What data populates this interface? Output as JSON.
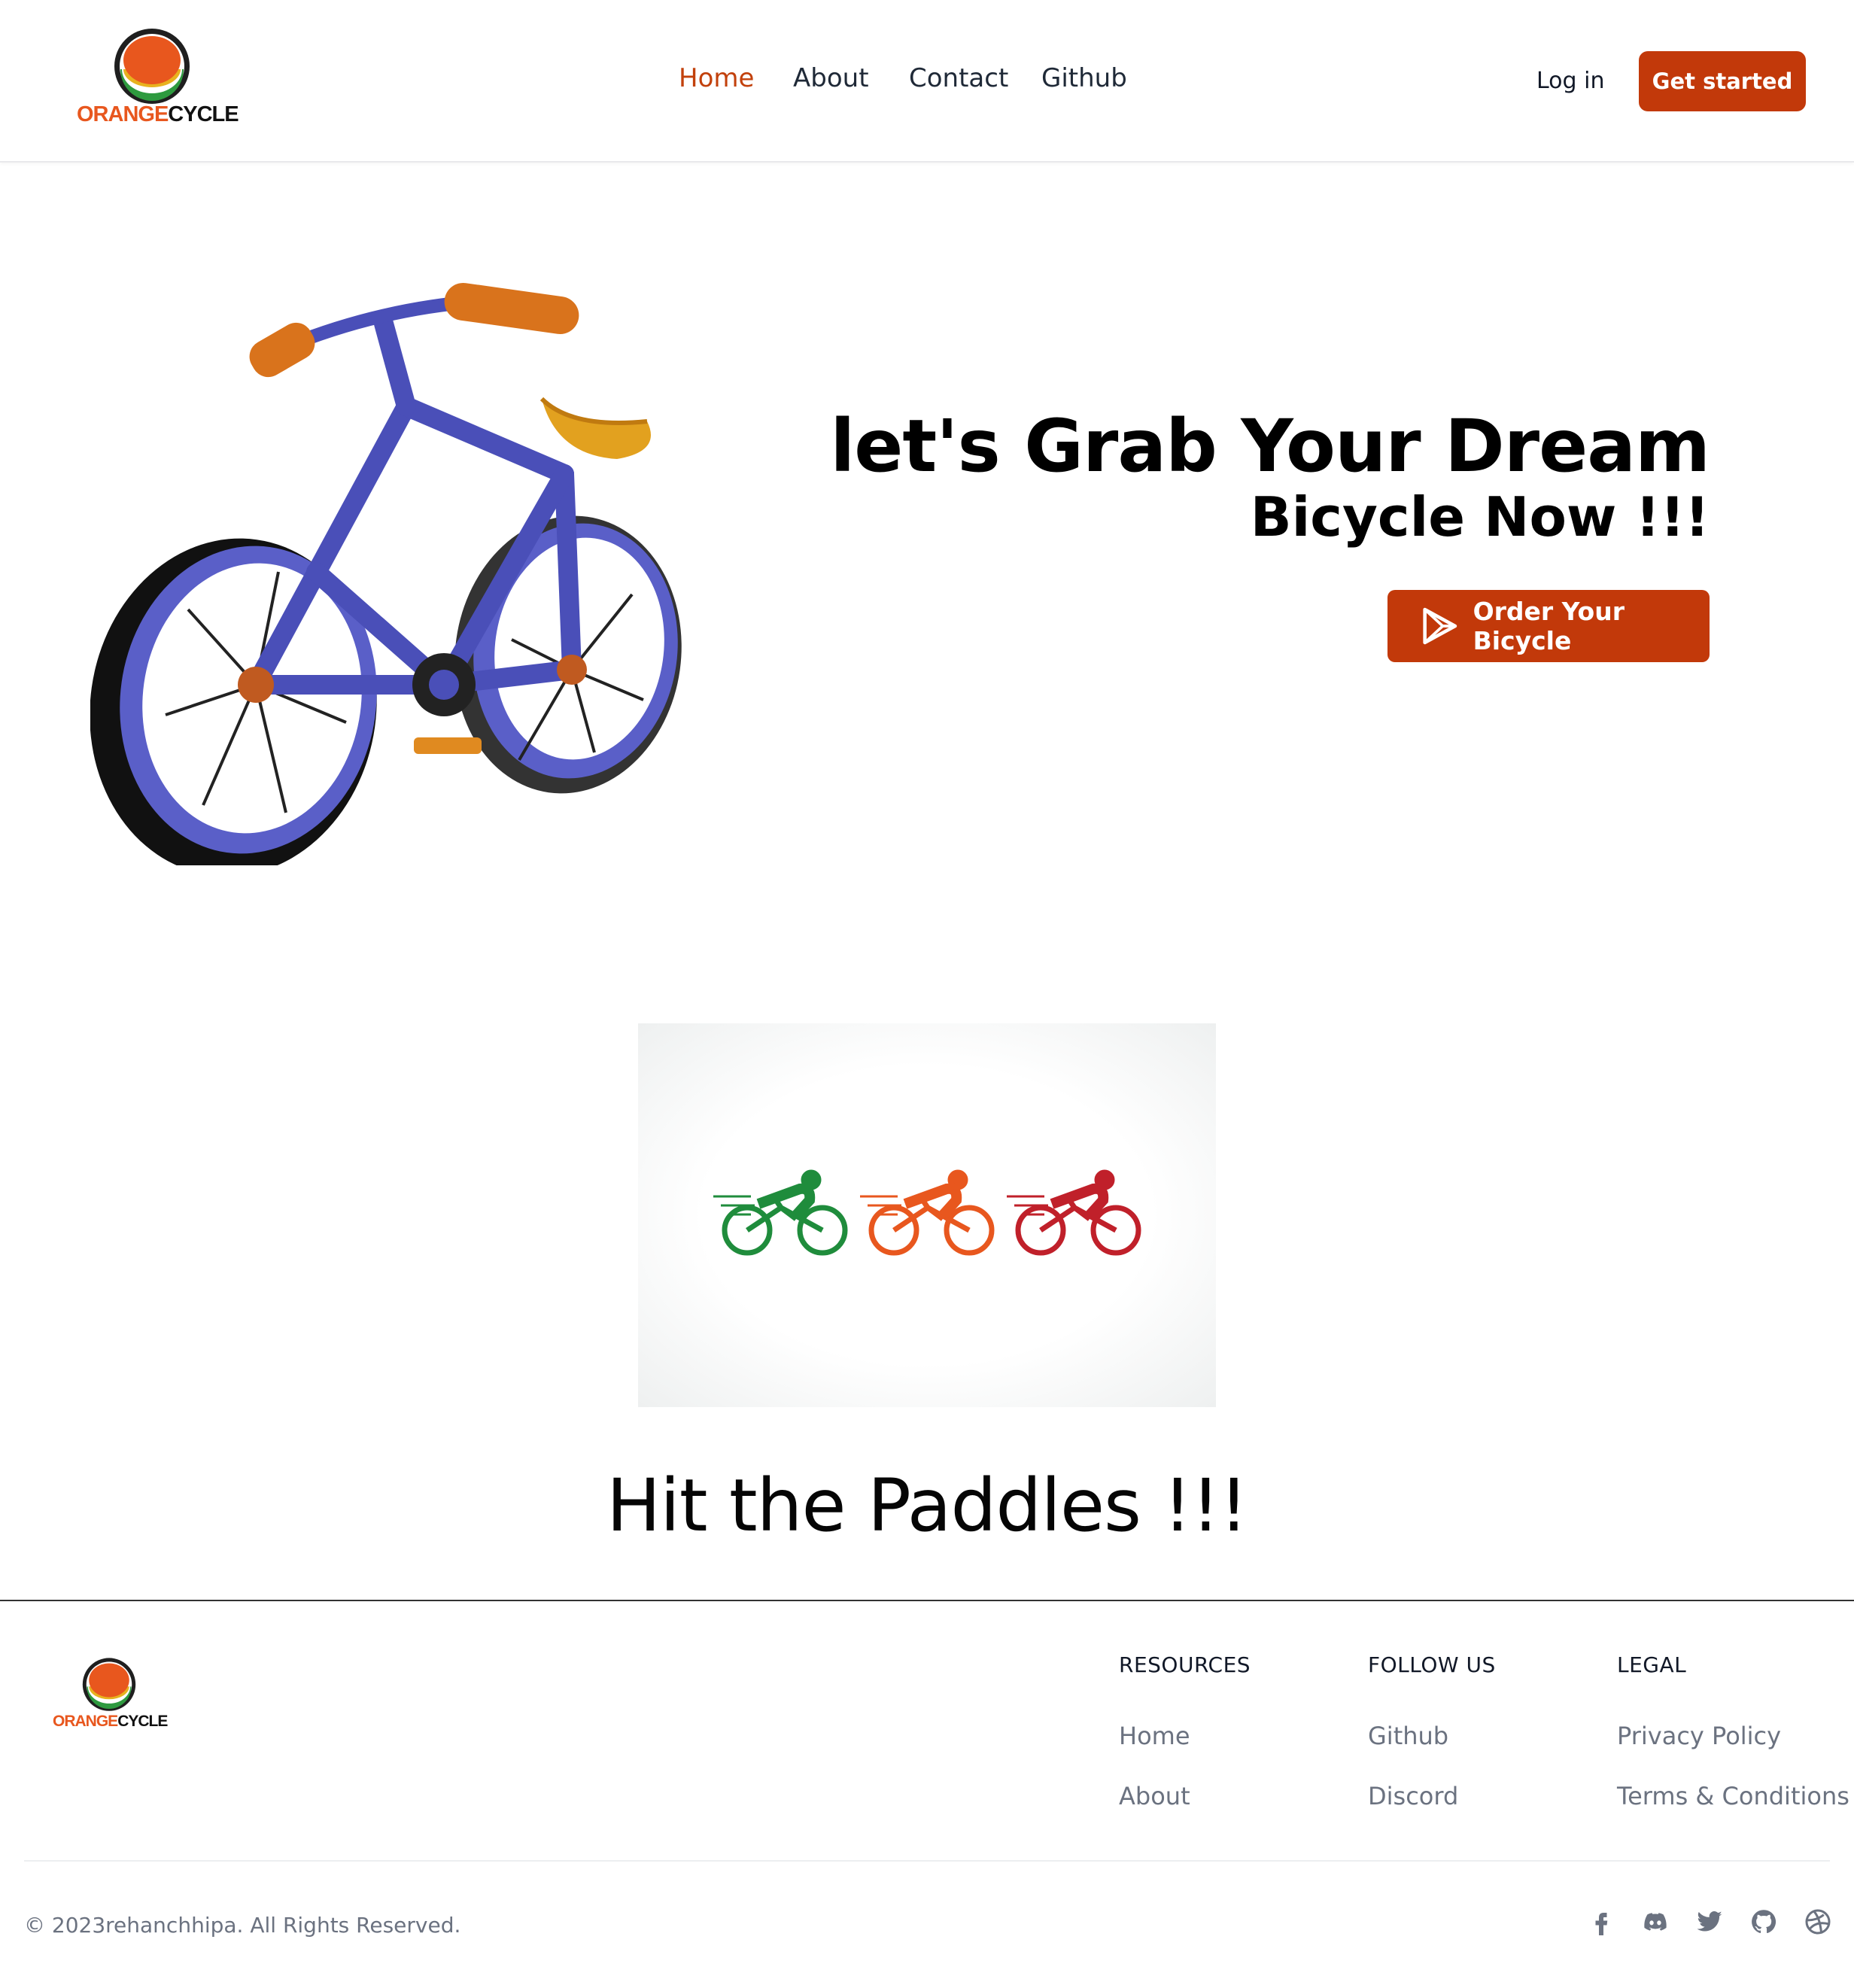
{
  "brand": {
    "name_orange": "ORANGE",
    "name_dark": "CYCLE"
  },
  "nav": {
    "items": [
      {
        "label": "Home",
        "active": true
      },
      {
        "label": "About",
        "active": false
      },
      {
        "label": "Contact",
        "active": false
      },
      {
        "label": "Github",
        "active": false
      }
    ],
    "login_label": "Log in",
    "get_started_label": "Get started"
  },
  "hero": {
    "title_line1": "let's Grab Your Dream",
    "title_line2": "Bicycle Now !!!",
    "cta_label": "Order Your Bicycle"
  },
  "section": {
    "heading": "Hit the Paddles !!!"
  },
  "footer": {
    "columns": [
      {
        "title": "RESOURCES",
        "links": [
          "Home",
          "About"
        ]
      },
      {
        "title": "FOLLOW US",
        "links": [
          "Github",
          "Discord"
        ]
      },
      {
        "title": "LEGAL",
        "links": [
          "Privacy Policy",
          "Terms & Conditions"
        ]
      }
    ],
    "copyright": "© 2023rehanchhipa. All Rights Reserved.",
    "socials": [
      "facebook-icon",
      "discord-icon",
      "twitter-icon",
      "github-icon",
      "dribbble-icon"
    ]
  },
  "colors": {
    "accent": "#c2390a",
    "link_active": "#c2410c",
    "muted": "#6b7280"
  }
}
